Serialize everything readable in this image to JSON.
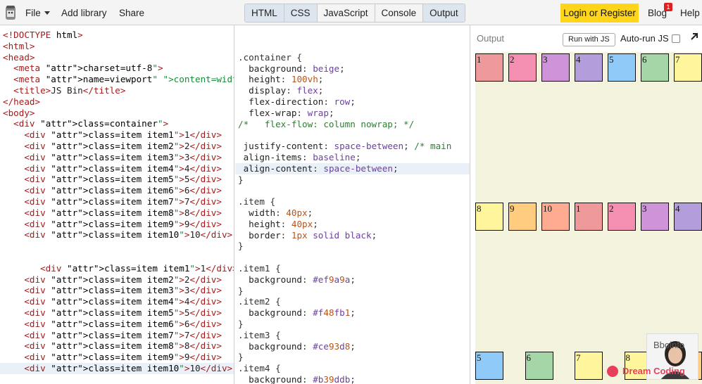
{
  "topbar": {
    "file_label": "File",
    "add_library_label": "Add library",
    "share_label": "Share",
    "tabs": [
      "HTML",
      "CSS",
      "JavaScript",
      "Console",
      "Output"
    ],
    "login_label": "Login or Register",
    "blog_label": "Blog",
    "blog_badge": "1",
    "help_label": "Help",
    "accent_color": "#ffd51a"
  },
  "html_panel": {
    "lines": [
      "<!DOCTYPE html>",
      "<html>",
      "<head>",
      "  <meta charset=\"utf-8\">",
      "  <meta name=\"viewport\" content=\"width=de",
      "  <title>JS Bin</title>",
      "</head>",
      "<body>",
      "  <div class=\"container\">",
      "    <div class=\"item item1\">1</div>",
      "    <div class=\"item item2\">2</div>",
      "    <div class=\"item item3\">3</div>",
      "    <div class=\"item item4\">4</div>",
      "    <div class=\"item item5\">5</div>",
      "    <div class=\"item item6\">6</div>",
      "    <div class=\"item item7\">7</div>",
      "    <div class=\"item item8\">8</div>",
      "    <div class=\"item item9\">9</div>",
      "    <div class=\"item item10\">10</div>",
      "",
      "",
      "       <div class=\"item item1\">1</div>",
      "    <div class=\"item item2\">2</div>",
      "    <div class=\"item item3\">3</div>",
      "    <div class=\"item item4\">4</div>",
      "    <div class=\"item item5\">5</div>",
      "    <div class=\"item item6\">6</div>",
      "    <div class=\"item item7\">7</div>",
      "    <div class=\"item item8\">8</div>",
      "    <div class=\"item item9\">9</div>",
      "    <div class=\"item item10\">10</div>"
    ],
    "highlight_line": 30
  },
  "css_panel": {
    "lines": [
      "",
      ".container {",
      "  background: beige;",
      "  height: 100vh;",
      "  display: flex;",
      "  flex-direction: row;",
      "  flex-wrap: wrap;",
      "/*   flex-flow: column nowrap; */",
      "",
      " justify-content: space-between; /* main",
      " align-items: baseline;",
      " align-content: space-between;",
      "}",
      "",
      ".item {",
      "  width: 40px;",
      "  height: 40px;",
      "  border: 1px solid black;",
      "}",
      "",
      ".item1 {",
      "  background: #ef9a9a;",
      "}",
      ".item2 {",
      "  background: #f48fb1;",
      "}",
      ".item3 {",
      "  background: #ce93d8;",
      "}",
      ".item4 {",
      "  background: #b39ddb;"
    ],
    "highlight_line": 11
  },
  "output": {
    "title": "Output",
    "run_label": "Run with JS",
    "autorun_label": "Auto-run JS",
    "background": "#f3f3dd",
    "rows": [
      [
        "1",
        "2",
        "3",
        "4",
        "5",
        "6",
        "7"
      ],
      [
        "8",
        "9",
        "10",
        "1",
        "2",
        "3",
        "4"
      ],
      [
        "5",
        "6",
        "7",
        "8",
        "9"
      ]
    ],
    "item_colors": {
      "1": "#ef9a9a",
      "2": "#f48fb1",
      "3": "#ce93d8",
      "4": "#b39ddb",
      "5": "#90caf9",
      "6": "#a5d6a7",
      "7": "#fff59d",
      "8": "#fff59d",
      "9": "#ffcc80",
      "10": "#ffab91"
    }
  },
  "overlay": {
    "avatar_text": "Bboinfo",
    "watermark": "Dream Coding"
  }
}
